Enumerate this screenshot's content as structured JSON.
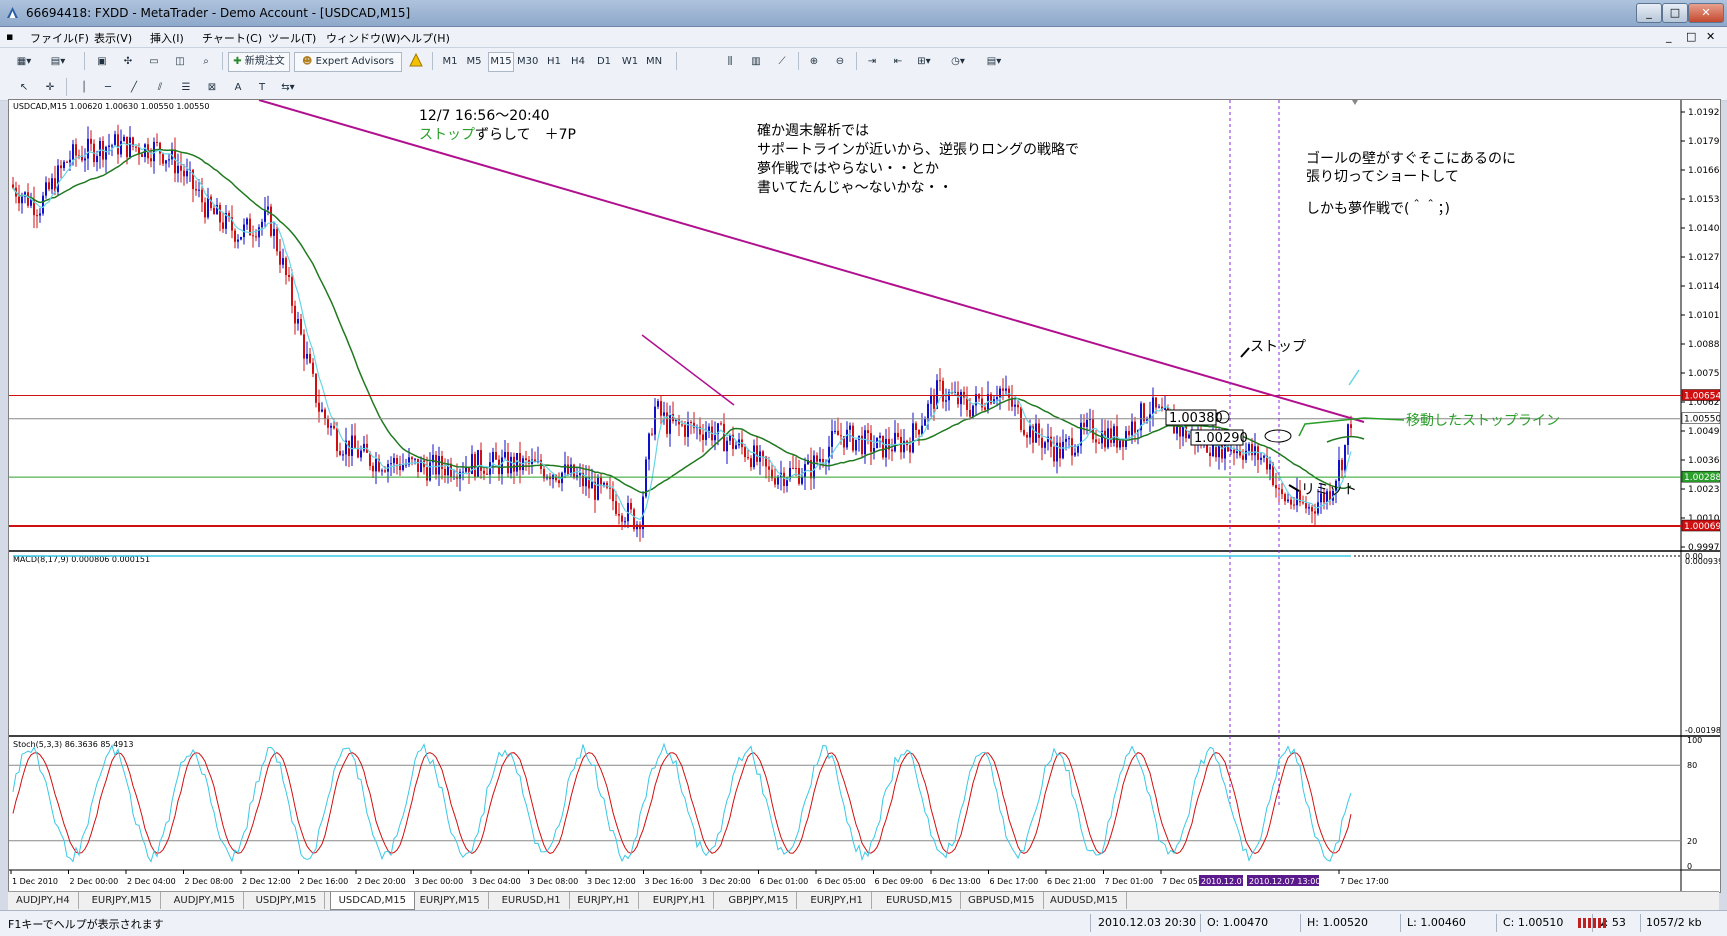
{
  "window": {
    "title": "66694418: FXDD - MetaTrader - Demo Account - [USDCAD,M15]",
    "controls": [
      "_",
      "□",
      "✕"
    ],
    "child_controls": [
      "_",
      "□",
      "✕"
    ]
  },
  "menu": [
    "ファイル(F)",
    "表示(V)",
    "挿入(I)",
    "チャート(C)",
    "ツール(T)",
    "ウィンドウ(W)",
    "ヘルプ(H)"
  ],
  "toolbar": {
    "new_order": "新規注文",
    "expert_advisors": "Expert Advisors",
    "timeframes": [
      "M1",
      "M5",
      "M15",
      "M30",
      "H1",
      "H4",
      "D1",
      "W1",
      "MN"
    ]
  },
  "chart": {
    "symbol_header": "USDCAD,M15  1.00620 1.00630 1.00550 1.00550",
    "macd_header": "MACD(8,17,9) 0.000806 0.000151",
    "stoch_header": "Stoch(5,3,3) 86.3636 85.4913",
    "price_axis": [
      "1.01925",
      "1.01795",
      "1.01665",
      "1.01535",
      "1.01405",
      "1.01275",
      "1.01145",
      "1.01015",
      "1.00885",
      "1.00755",
      "1.00625",
      "1.00495",
      "1.00365",
      "1.00235",
      "1.00105",
      "0.99975"
    ],
    "price_tags": {
      "resistance": "1.00654",
      "current": "1.00550",
      "support_green": "1.00288",
      "limit": "1.00069"
    },
    "macd_axis": [
      "0.000939",
      "0.00",
      "-0.00198"
    ],
    "stoch_axis": [
      "100",
      "80",
      "20",
      "0"
    ],
    "time_axis": [
      "1 Dec 2010",
      "2 Dec 00:00",
      "2 Dec 04:00",
      "2 Dec 08:00",
      "2 Dec 12:00",
      "2 Dec 16:00",
      "2 Dec 20:00",
      "3 Dec 00:00",
      "3 Dec 04:00",
      "3 Dec 08:00",
      "3 Dec 12:00",
      "3 Dec 16:00",
      "3 Dec 20:00",
      "6 Dec 01:00",
      "6 Dec 05:00",
      "6 Dec 09:00",
      "6 Dec 13:00",
      "6 Dec 17:00",
      "6 Dec 21:00",
      "7 Dec 01:00",
      "7 Dec 05:",
      "7 Dec 17:00"
    ],
    "vline_labels": [
      "2010.12.07",
      "2010.12.07 13:00"
    ],
    "price_labels": [
      "1.00380",
      "1.00290"
    ],
    "colors": {
      "bull": "#1010c8",
      "bear": "#d01010",
      "ma_slow": "#1f7a1f",
      "ma_fast": "#66d6e6",
      "trend": "#b0108e",
      "macd_hist": "#1f8a1f",
      "macd_signal": "#39c8e6",
      "stoch_main": "#39c8e6",
      "stoch_signal": "#d01010",
      "resistance": "#d01010",
      "support": "#2aa02a"
    }
  },
  "annotations": {
    "a1_line1": "12/7 16:56〜20:40",
    "a1_green": "ストップ",
    "a1_rest": "ずらして　＋7P",
    "a2_line1": "確か週末解析では",
    "a2_line2": "サポートラインが近いから、逆張りロングの戦略で",
    "a2_line3": "夢作戦ではやらない・・とか",
    "a2_line4": "書いてたんじゃ〜ないかな・・",
    "a3_line1": "ゴールの壁がすぐそこにあるのに",
    "a3_line2": "張り切ってショートして",
    "a3_line3": "しかも夢作戦で(＾＾；)",
    "stop": "ストップ",
    "moved_stop": "移動したストップライン",
    "limit": "リミット"
  },
  "tabs": [
    "AUDJPY,H4",
    "EURJPY,M15",
    "AUDJPY,M15",
    "USDJPY,M15",
    "USDCAD,M15",
    "EURJPY,M15",
    "EURUSD,H1",
    "EURJPY,H1",
    "EURJPY,H1",
    "GBPJPY,M15",
    "EURJPY,H1",
    "EURUSD,M15",
    "GBPUSD,M15",
    "AUDUSD,M15"
  ],
  "active_tab": "USDCAD,M15",
  "status": {
    "help": "F1キーでヘルプが表示されます",
    "datetime": "2010.12.03 20:30",
    "open": "O: 1.00470",
    "high": "H: 1.00520",
    "low": "L: 1.00460",
    "close": "C: 1.00510",
    "volume": "V: 53",
    "traffic": "1057/2 kb"
  }
}
